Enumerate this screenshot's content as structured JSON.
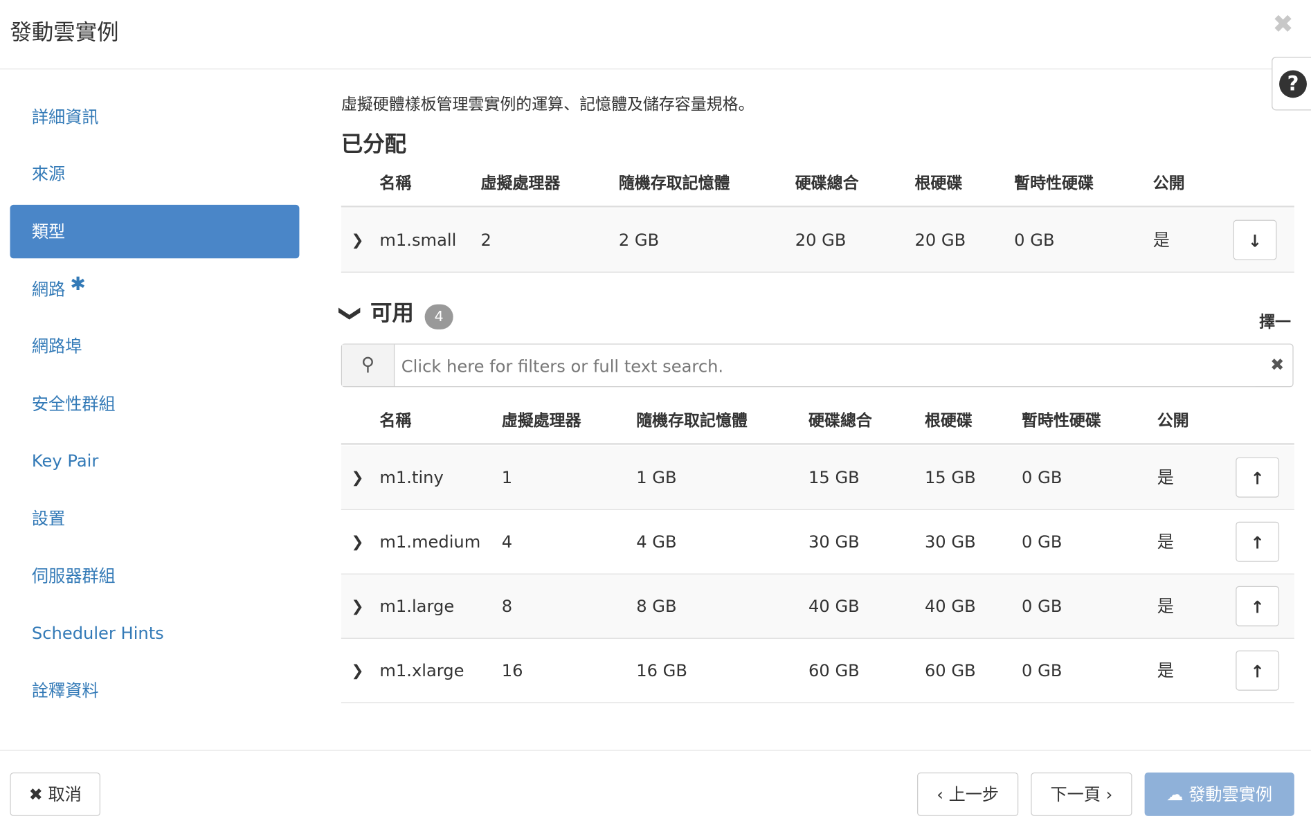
{
  "header": {
    "title": "發動雲實例",
    "close_icon": "close-icon",
    "help_label": "?"
  },
  "sidebar": {
    "items": [
      {
        "label": "詳細資訊"
      },
      {
        "label": "來源"
      },
      {
        "label": "類型",
        "active": true
      },
      {
        "label": "網路",
        "required": "✱"
      },
      {
        "label": "網路埠"
      },
      {
        "label": "安全性群組"
      },
      {
        "label": "Key Pair"
      },
      {
        "label": "設置"
      },
      {
        "label": "伺服器群組"
      },
      {
        "label": "Scheduler Hints"
      },
      {
        "label": "詮釋資料"
      }
    ]
  },
  "main": {
    "description": "虛擬硬體樣板管理雲實例的運算、記憶體及儲存容量規格。",
    "allocated": {
      "title": "已分配",
      "columns": [
        "名稱",
        "虛擬處理器",
        "隨機存取記憶體",
        "硬碟總合",
        "根硬碟",
        "暫時性硬碟",
        "公開"
      ],
      "rows": [
        [
          "m1.small",
          "2",
          "2 GB",
          "20 GB",
          "20 GB",
          "0 GB",
          "是"
        ]
      ]
    },
    "available": {
      "title": "可用",
      "count": "4",
      "select_one": "擇一",
      "search_placeholder": "Click here for filters or full text search.",
      "columns": [
        "名稱",
        "虛擬處理器",
        "隨機存取記憶體",
        "硬碟總合",
        "根硬碟",
        "暫時性硬碟",
        "公開"
      ],
      "rows": [
        [
          "m1.tiny",
          "1",
          "1 GB",
          "15 GB",
          "15 GB",
          "0 GB",
          "是"
        ],
        [
          "m1.medium",
          "4",
          "4 GB",
          "30 GB",
          "30 GB",
          "0 GB",
          "是"
        ],
        [
          "m1.large",
          "8",
          "8 GB",
          "40 GB",
          "40 GB",
          "0 GB",
          "是"
        ],
        [
          "m1.xlarge",
          "16",
          "16 GB",
          "60 GB",
          "60 GB",
          "0 GB",
          "是"
        ]
      ]
    }
  },
  "footer": {
    "cancel": "取消",
    "prev": "上一步",
    "next": "下一頁",
    "launch": "發動雲實例"
  },
  "colors": {
    "accent": "#4a86c8",
    "link": "#337ab7",
    "launch_disabled": "#8fb1d9"
  }
}
